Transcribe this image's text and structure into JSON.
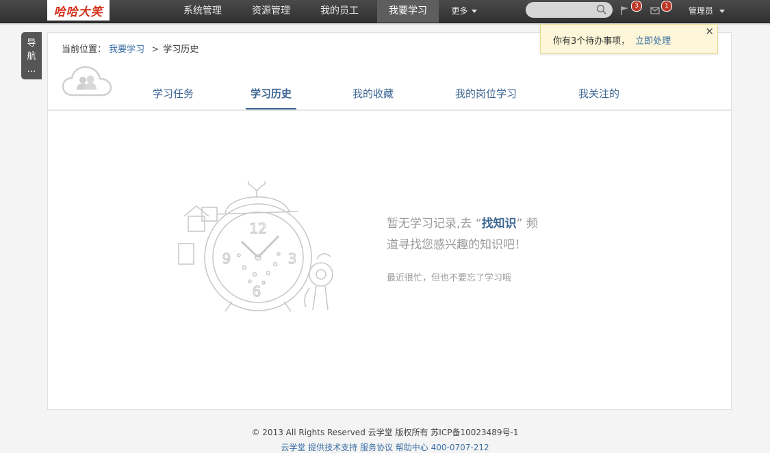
{
  "brand": {
    "logo_text": "哈哈大笑"
  },
  "topnav": {
    "items": [
      {
        "label": "系统管理",
        "active": false
      },
      {
        "label": "资源管理",
        "active": false
      },
      {
        "label": "我的员工",
        "active": false
      },
      {
        "label": "我要学习",
        "active": true
      }
    ],
    "more_label": "更多",
    "search_placeholder": "",
    "flag_count": "3",
    "mail_count": "1",
    "user_label": "管理员"
  },
  "sidenav": {
    "label_chars": [
      "导",
      "航",
      "..."
    ]
  },
  "notice": {
    "message": "你有3个待办事项，",
    "action": "立即处理",
    "close": "✕"
  },
  "breadcrumb": {
    "prefix": "当前位置：",
    "parent": "我要学习",
    "separator": ">",
    "current": "学习历史"
  },
  "tabs": [
    {
      "label": "学习任务",
      "active": false
    },
    {
      "label": "学习历史",
      "active": true
    },
    {
      "label": "我的收藏",
      "active": false
    },
    {
      "label": "我的岗位学习",
      "active": false
    },
    {
      "label": "我关注的",
      "active": false
    }
  ],
  "empty_state": {
    "line1_before": "暂无学习记录,去 “",
    "line1_link": "找知识",
    "line1_after": "” 频",
    "line2": "道寻找您感兴趣的知识吧！",
    "sub": "最近很忙，但也不要忘了学习哦",
    "clock_numbers": [
      "12",
      "3",
      "6",
      "9"
    ]
  },
  "footer": {
    "line1": "© 2013 All Rights Reserved  云学堂 版权所有  苏ICP备10023489号-1",
    "line2": "云学堂 提供技术支持   服务协议   帮助中心   400-0707-212"
  },
  "colors": {
    "accent": "#3d6693",
    "topbar": "#3a3a3a",
    "notice_bg": "#fdf6d8"
  }
}
